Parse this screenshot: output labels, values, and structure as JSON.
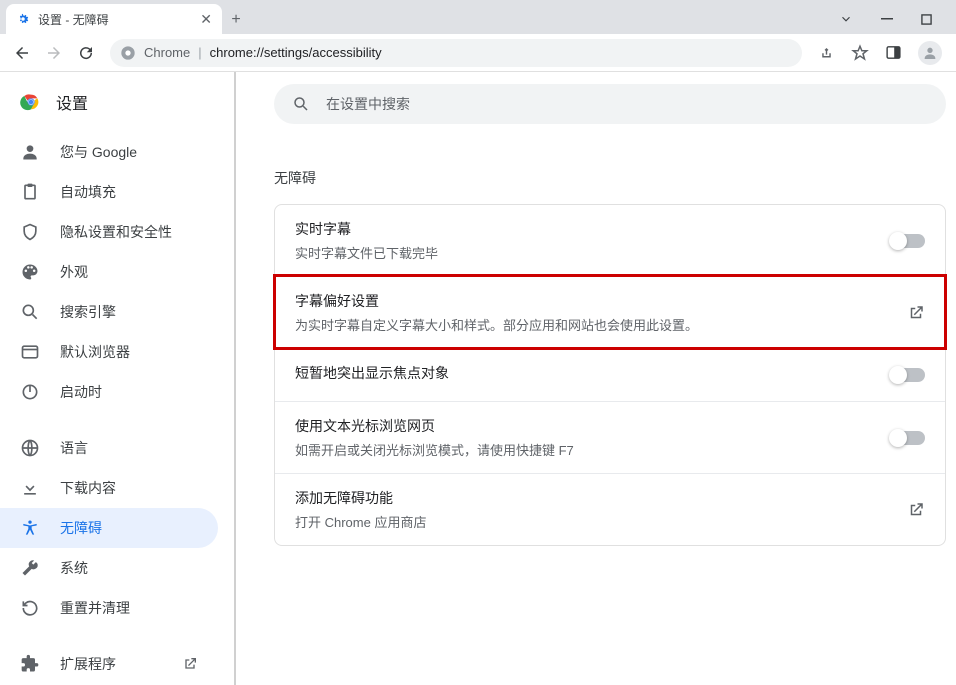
{
  "window": {
    "tab_title": "设置 - 无障碍"
  },
  "omnibox": {
    "chrome_label": "Chrome",
    "url_text": "chrome://settings/accessibility"
  },
  "sidebar": {
    "header": "设置",
    "items": [
      {
        "label": "您与 Google"
      },
      {
        "label": "自动填充"
      },
      {
        "label": "隐私设置和安全性"
      },
      {
        "label": "外观"
      },
      {
        "label": "搜索引擎"
      },
      {
        "label": "默认浏览器"
      },
      {
        "label": "启动时"
      },
      {
        "label": "语言"
      },
      {
        "label": "下载内容"
      },
      {
        "label": "无障碍"
      },
      {
        "label": "系统"
      },
      {
        "label": "重置并清理"
      },
      {
        "label": "扩展程序"
      }
    ]
  },
  "main": {
    "search_placeholder": "在设置中搜索",
    "section_title": "无障碍",
    "rows": [
      {
        "title": "实时字幕",
        "desc": "实时字幕文件已下载完毕"
      },
      {
        "title": "字幕偏好设置",
        "desc": "为实时字幕自定义字幕大小和样式。部分应用和网站也会使用此设置。"
      },
      {
        "title": "短暂地突出显示焦点对象",
        "desc": ""
      },
      {
        "title": "使用文本光标浏览网页",
        "desc": "如需开启或关闭光标浏览模式，请使用快捷键 F7"
      },
      {
        "title": "添加无障碍功能",
        "desc": "打开 Chrome 应用商店"
      }
    ]
  }
}
